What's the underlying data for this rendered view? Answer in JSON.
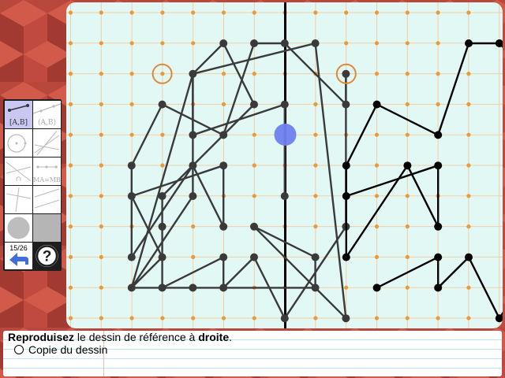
{
  "colors": {
    "board_bg": "#e2f8f5",
    "grid_line": "#f0cfa6",
    "grid_dot": "#ea9a3a",
    "model_line": "#3a3a3a",
    "drawing_line": "#000000",
    "start_marker": "#e0883a",
    "cursor": "#6f7ff0",
    "active_tool": "#c9c8f3"
  },
  "toolbar": {
    "tools": [
      {
        "name": "segment",
        "label": "[A,B]",
        "active": true
      },
      {
        "name": "line",
        "label": "(A,B)",
        "active": false
      },
      {
        "name": "circle",
        "label": "",
        "active": false
      },
      {
        "name": "lines",
        "label": "",
        "active": false
      },
      {
        "name": "intersection",
        "label": "∩",
        "active": false
      },
      {
        "name": "equal-length",
        "label": "MA=MB",
        "active": false
      },
      {
        "name": "perpendicular",
        "label": "",
        "active": false
      },
      {
        "name": "parallel",
        "label": "",
        "active": false
      },
      {
        "name": "point-color",
        "label": "",
        "active": false
      },
      {
        "name": "fill-color",
        "label": "",
        "active": false
      }
    ],
    "page_counter": "15/26",
    "back_icon": "back-arrow-icon",
    "help_icon": "help-icon"
  },
  "instruction": {
    "verb": "Reproduisez",
    "middle": " le dessin de référence à ",
    "target": "droite",
    "end": "."
  },
  "option": {
    "label": "Copie du dessin"
  },
  "model_segments": [
    [
      [
        3,
        1
      ],
      [
        4,
        0
      ]
    ],
    [
      [
        4,
        0
      ],
      [
        5,
        2
      ]
    ],
    [
      [
        5,
        2
      ],
      [
        2,
        5
      ]
    ],
    [
      [
        2,
        5
      ],
      [
        2,
        6
      ]
    ],
    [
      [
        2,
        6
      ],
      [
        2,
        8
      ]
    ],
    [
      [
        2,
        8
      ],
      [
        4,
        7
      ]
    ],
    [
      [
        4,
        7
      ],
      [
        4,
        8
      ]
    ],
    [
      [
        4,
        8
      ],
      [
        5,
        7
      ]
    ],
    [
      [
        5,
        7
      ],
      [
        6,
        9
      ]
    ],
    [
      [
        6,
        9
      ],
      [
        8,
        6
      ]
    ],
    [
      [
        8,
        6
      ],
      [
        8,
        1
      ]
    ],
    [
      [
        8,
        1
      ],
      [
        8,
        2
      ]
    ],
    [
      [
        8,
        2
      ],
      [
        6,
        0
      ]
    ],
    [
      [
        6,
        0
      ],
      [
        5,
        0
      ]
    ],
    [
      [
        5,
        0
      ],
      [
        4,
        3
      ]
    ],
    [
      [
        4,
        3
      ],
      [
        2,
        2
      ]
    ],
    [
      [
        2,
        2
      ],
      [
        1,
        4
      ]
    ],
    [
      [
        1,
        4
      ],
      [
        1,
        7
      ]
    ],
    [
      [
        1,
        7
      ],
      [
        3,
        4
      ]
    ],
    [
      [
        3,
        4
      ],
      [
        4,
        6
      ]
    ],
    [
      [
        4,
        6
      ],
      [
        4,
        4
      ]
    ],
    [
      [
        4,
        4
      ],
      [
        1,
        5
      ]
    ],
    [
      [
        1,
        5
      ],
      [
        2,
        7
      ]
    ],
    [
      [
        2,
        7
      ],
      [
        1,
        8
      ]
    ],
    [
      [
        1,
        8
      ],
      [
        3,
        1
      ]
    ],
    [
      [
        3,
        1
      ],
      [
        3,
        5
      ]
    ],
    [
      [
        3,
        5
      ],
      [
        1,
        8
      ]
    ],
    [
      [
        1,
        8
      ],
      [
        3,
        8
      ]
    ],
    [
      [
        3,
        8
      ],
      [
        7,
        8
      ]
    ],
    [
      [
        7,
        8
      ],
      [
        7,
        7
      ]
    ],
    [
      [
        7,
        7
      ],
      [
        5,
        6
      ]
    ],
    [
      [
        5,
        6
      ],
      [
        8,
        9
      ]
    ],
    [
      [
        8,
        9
      ],
      [
        7,
        0
      ]
    ],
    [
      [
        7,
        0
      ],
      [
        3,
        1
      ]
    ],
    [
      [
        3,
        1
      ],
      [
        3,
        3
      ]
    ],
    [
      [
        3,
        3
      ],
      [
        6,
        2
      ]
    ],
    [
      [
        6,
        2
      ],
      [
        6,
        5
      ]
    ]
  ],
  "model_points": [
    [
      3,
      1
    ],
    [
      4,
      0
    ],
    [
      5,
      2
    ],
    [
      2,
      5
    ],
    [
      2,
      6
    ],
    [
      2,
      8
    ],
    [
      4,
      7
    ],
    [
      4,
      8
    ],
    [
      5,
      7
    ],
    [
      6,
      9
    ],
    [
      8,
      6
    ],
    [
      8,
      1
    ],
    [
      8,
      2
    ],
    [
      6,
      0
    ],
    [
      5,
      0
    ],
    [
      4,
      3
    ],
    [
      2,
      2
    ],
    [
      1,
      4
    ],
    [
      1,
      7
    ],
    [
      3,
      4
    ],
    [
      4,
      6
    ],
    [
      4,
      4
    ],
    [
      1,
      5
    ],
    [
      2,
      7
    ],
    [
      1,
      8
    ],
    [
      3,
      5
    ],
    [
      3,
      8
    ],
    [
      7,
      8
    ],
    [
      7,
      7
    ],
    [
      5,
      6
    ],
    [
      8,
      9
    ],
    [
      7,
      0
    ],
    [
      3,
      3
    ],
    [
      6,
      2
    ],
    [
      6,
      5
    ]
  ],
  "drawing_segments": [
    [
      [
        2,
        8
      ],
      [
        4,
        7
      ]
    ],
    [
      [
        4,
        7
      ],
      [
        4,
        8
      ]
    ],
    [
      [
        4,
        8
      ],
      [
        5,
        7
      ]
    ],
    [
      [
        5,
        7
      ],
      [
        6,
        9
      ]
    ],
    [
      [
        6,
        9
      ],
      [
        8,
        6
      ]
    ],
    [
      [
        8,
        6
      ],
      [
        8,
        1
      ]
    ],
    [
      [
        8,
        1
      ],
      [
        8,
        2
      ]
    ],
    [
      [
        8,
        2
      ],
      [
        6,
        0
      ]
    ],
    [
      [
        6,
        0
      ],
      [
        5,
        0
      ]
    ],
    [
      [
        5,
        0
      ],
      [
        4,
        3
      ]
    ],
    [
      [
        4,
        3
      ],
      [
        2,
        2
      ]
    ],
    [
      [
        2,
        2
      ],
      [
        1,
        4
      ]
    ],
    [
      [
        1,
        4
      ],
      [
        1,
        7
      ]
    ],
    [
      [
        1,
        7
      ],
      [
        3,
        4
      ]
    ],
    [
      [
        3,
        4
      ],
      [
        4,
        6
      ]
    ],
    [
      [
        4,
        6
      ],
      [
        4,
        4
      ]
    ],
    [
      [
        4,
        4
      ],
      [
        1,
        5
      ]
    ]
  ],
  "drawing_points": [
    [
      2,
      8
    ],
    [
      4,
      7
    ],
    [
      4,
      8
    ],
    [
      5,
      7
    ],
    [
      6,
      9
    ],
    [
      8,
      6
    ],
    [
      8,
      1
    ],
    [
      8,
      2
    ],
    [
      6,
      0
    ],
    [
      5,
      0
    ],
    [
      4,
      3
    ],
    [
      2,
      2
    ],
    [
      1,
      4
    ],
    [
      1,
      7
    ],
    [
      3,
      4
    ],
    [
      4,
      6
    ],
    [
      4,
      4
    ],
    [
      1,
      5
    ]
  ]
}
